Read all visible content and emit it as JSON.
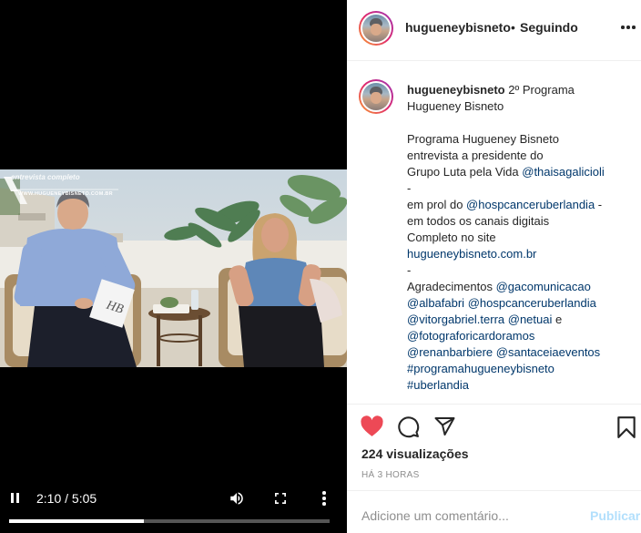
{
  "video": {
    "overlay_title": "entrevista completo",
    "overlay_site": "WWW.HUGUENEYBISNETO.COM.BR",
    "book_logo": "HB",
    "time": "2:10 / 5:05",
    "progress": 0.42,
    "icons": {
      "play_state": "pause-icon",
      "volume": "volume-icon",
      "fullscreen": "fullscreen-icon",
      "more": "more-vertical-icon"
    }
  },
  "header": {
    "username": "hugueneybisneto",
    "separator": "•",
    "follow_status": "Seguindo",
    "more_icon": "more-horizontal-icon"
  },
  "caption": {
    "username": "hugueneybisneto",
    "line1_rest": " 2º Programa",
    "line2": "Hugueney Bisneto",
    "line3": "Programa Hugueney Bisneto",
    "line4": "entrevista a presidente do",
    "line5_text": "Grupo Luta pela Vida ",
    "line5_link": "@thaisagalicioli",
    "line6": "-",
    "line7_text": "em prol do ",
    "line7_link": "@hospcanceruberlandia",
    "line7_tail": " -",
    "line8": "em todos os canais digitais",
    "line9": "Completo no site",
    "line10_link": "hugueneybisneto.com.br",
    "line11": "-",
    "line12_text": "Agradecimentos ",
    "line12_link": "@gacomunicacao",
    "line13_link1": "@albafabri",
    "line13_link2": "@hospcanceruberlandia",
    "line14_link1": "@vitorgabriel.terra",
    "line14_link2": "@netuai",
    "line14_tail": " e",
    "line15_link": "@fotograforicardoramos",
    "line16_link1": "@renanbarbiere",
    "line16_link2": "@santaceiaeventos",
    "line17_link": "#programahugueneybisneto",
    "line18_link": "#uberlandia"
  },
  "actions": {
    "like_icon": "heart-icon",
    "comment_icon": "comment-icon",
    "share_icon": "share-icon",
    "save_icon": "bookmark-icon",
    "like_color": "#ed4956"
  },
  "stats": {
    "views": "224 visualizações",
    "time_ago": "HÁ 3 HORAS"
  },
  "comment_box": {
    "placeholder": "Adicione um comentário...",
    "publish": "Publicar",
    "publish_color": "#b2dffc"
  }
}
